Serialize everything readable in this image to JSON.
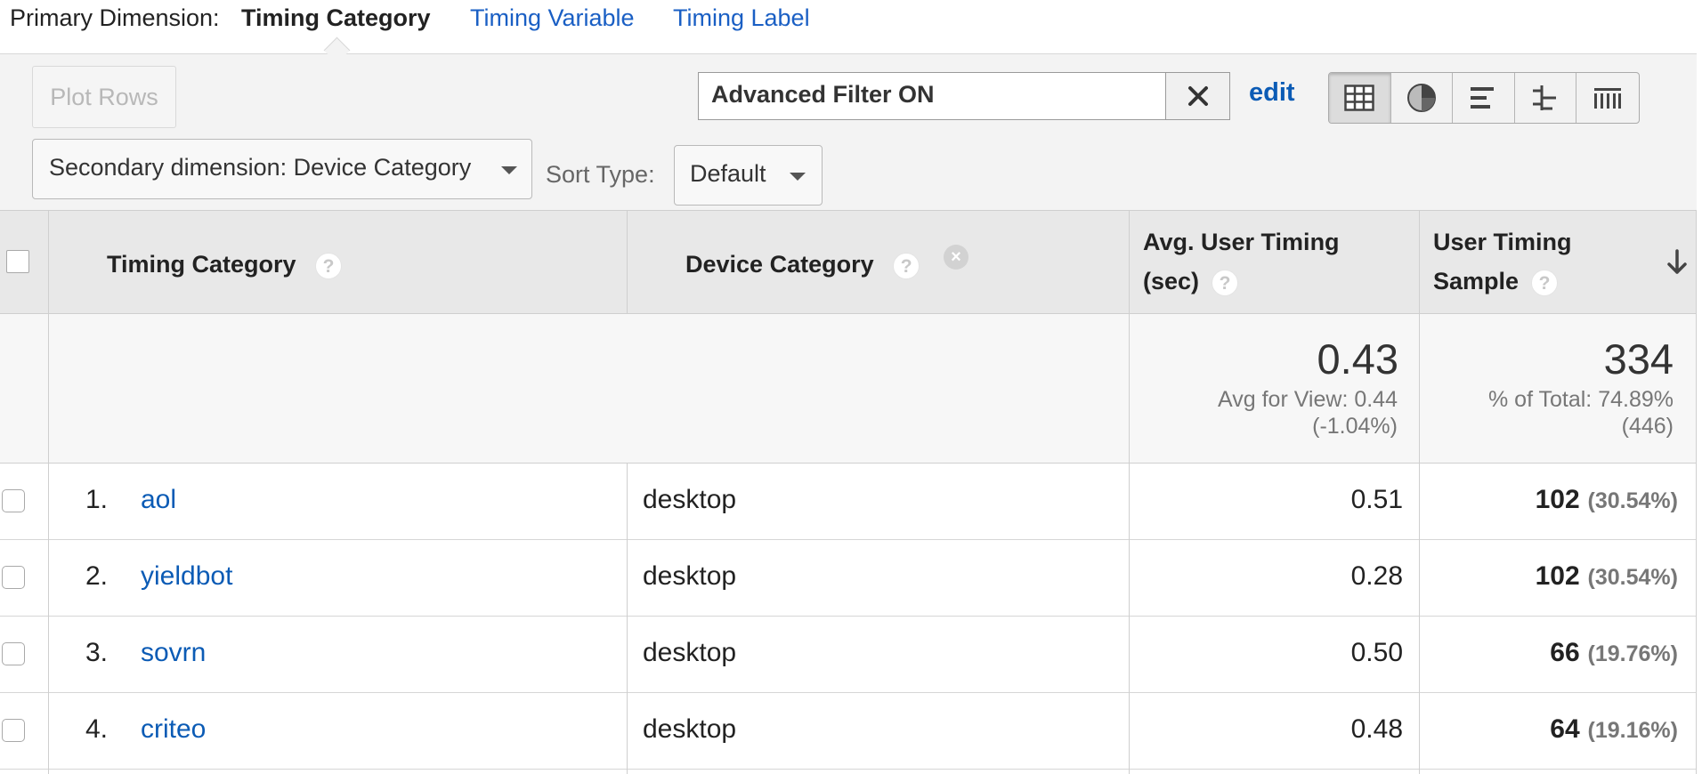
{
  "primary_dimension": {
    "label": "Primary Dimension:",
    "active": "Timing Category",
    "links": [
      "Timing Variable",
      "Timing Label"
    ]
  },
  "toolbar": {
    "plot_rows": "Plot Rows",
    "filter_text": "Advanced Filter ON",
    "clear_icon": "close-icon",
    "edit": "edit",
    "view_modes": [
      "table-view",
      "pie-view",
      "performance-view",
      "comparison-view",
      "pivot-view"
    ],
    "secondary_dimension": "Secondary dimension: Device Category",
    "sort_type_label": "Sort Type:",
    "sort_type_value": "Default"
  },
  "table": {
    "columns": {
      "timing_category": "Timing Category",
      "device_category": "Device Category",
      "avg_timing_line1": "Avg. User Timing",
      "avg_timing_line2": "(sec)",
      "sample_line1": "User Timing",
      "sample_line2": "Sample"
    },
    "summary": {
      "avg_value": "0.43",
      "avg_sub1": "Avg for View: 0.44",
      "avg_sub2": "(-1.04%)",
      "sample_value": "334",
      "sample_sub1": "% of Total: 74.89%",
      "sample_sub2": "(446)"
    },
    "rows": [
      {
        "index": "1.",
        "category": "aol",
        "device": "desktop",
        "avg": "0.51",
        "sample": "102",
        "pct": "(30.54%)"
      },
      {
        "index": "2.",
        "category": "yieldbot",
        "device": "desktop",
        "avg": "0.28",
        "sample": "102",
        "pct": "(30.54%)"
      },
      {
        "index": "3.",
        "category": "sovrn",
        "device": "desktop",
        "avg": "0.50",
        "sample": "66",
        "pct": "(19.76%)"
      },
      {
        "index": "4.",
        "category": "criteo",
        "device": "desktop",
        "avg": "0.48",
        "sample": "64",
        "pct": "(19.16%)"
      }
    ]
  }
}
